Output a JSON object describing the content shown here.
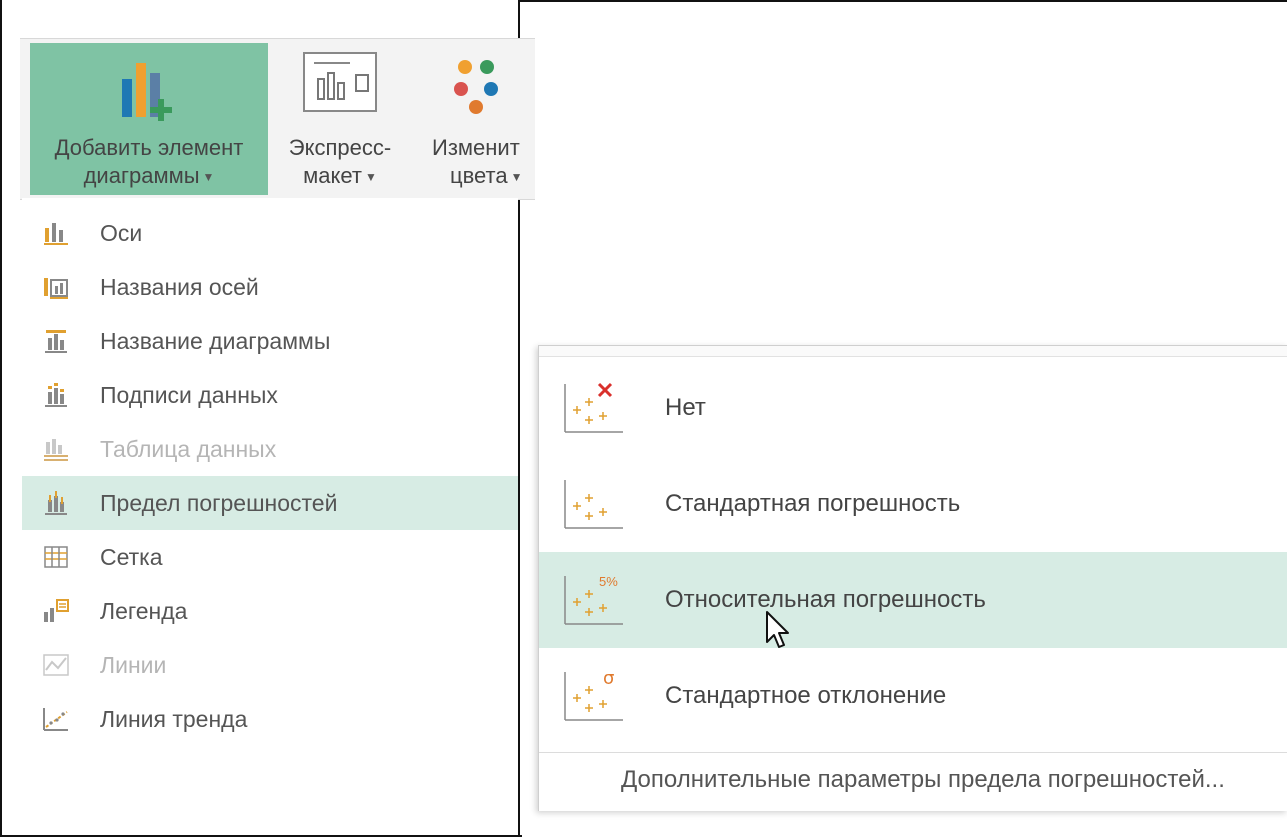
{
  "ribbon": {
    "add_element": {
      "line1": "Добавить элемент",
      "line2": "диаграммы"
    },
    "quick_layout": {
      "line1": "Экспресс-",
      "line2": "макет"
    },
    "change_colors": {
      "line1": "Изменит",
      "line2": "цвета"
    }
  },
  "chart_elements_menu": {
    "items": [
      {
        "label": "Оси",
        "enabled": true
      },
      {
        "label": "Названия осей",
        "enabled": true
      },
      {
        "label": "Название диаграммы",
        "enabled": true
      },
      {
        "label": "Подписи данных",
        "enabled": true
      },
      {
        "label": "Таблица данных",
        "enabled": false
      },
      {
        "label": "Предел погрешностей",
        "enabled": true,
        "highlighted": true
      },
      {
        "label": "Сетка",
        "enabled": true
      },
      {
        "label": "Легенда",
        "enabled": true
      },
      {
        "label": "Линии",
        "enabled": false
      },
      {
        "label": "Линия тренда",
        "enabled": true
      }
    ]
  },
  "error_bars_submenu": {
    "items": [
      {
        "label": "Нет",
        "badge": "×"
      },
      {
        "label": "Стандартная погрешность",
        "badge": ""
      },
      {
        "label": "Относительная погрешность",
        "badge": "5%",
        "highlighted": true
      },
      {
        "label": "Стандартное отклонение",
        "badge": "σ"
      }
    ],
    "more_options": "Дополнительные параметры предела погрешностей..."
  },
  "colors": {
    "active_button": "#7fc3a4",
    "highlight_row": "#d7ece4",
    "accent_orange": "#e07a2e",
    "accent_red": "#d9302c"
  }
}
